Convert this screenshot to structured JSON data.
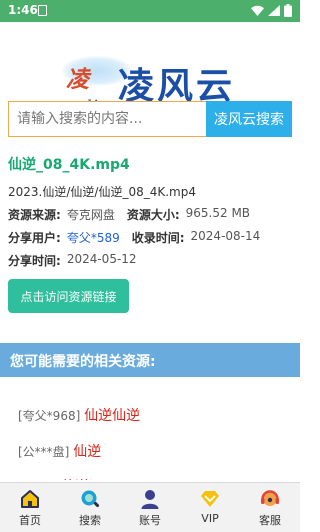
{
  "status_bar": {
    "time": "1:46"
  },
  "logo": {
    "brand_char": "凌",
    "title": "凌风云",
    "domain": "www.lingfengyun.com"
  },
  "search": {
    "placeholder": "请输入搜索的内容...",
    "button_label": "凌风云搜索"
  },
  "file": {
    "name": "仙逆_08_4K.mp4",
    "path": "2023.仙逆/仙逆/仙逆_08_4K.mp4",
    "source_label": "资源来源:",
    "source_value": "夸克网盘",
    "size_label": "资源大小:",
    "size_value": "965.52 MB",
    "sharer_label": "分享用户:",
    "sharer_value": "夸父*589",
    "collected_label": "收录时间:",
    "collected_value": "2024-08-14",
    "shared_label": "分享时间:",
    "shared_value": "2024-05-12"
  },
  "visit_button": "点击访问资源链接",
  "related": {
    "heading": "您可能需要的相关资源:",
    "items": [
      {
        "who": "[夸父*968]",
        "title": "仙逆仙逆"
      },
      {
        "who": "[公***盘]",
        "title": "仙逆"
      },
      {
        "who": "[*****]",
        "title": "仙逆"
      }
    ]
  },
  "bottom_nav": [
    {
      "label": "首页",
      "icon": "home-icon"
    },
    {
      "label": "搜索",
      "icon": "search-icon"
    },
    {
      "label": "账号",
      "icon": "user-icon"
    },
    {
      "label": "VIP",
      "icon": "vip-icon"
    },
    {
      "label": "客服",
      "icon": "support-icon"
    }
  ],
  "colors": {
    "status_bar": "#4caf6b",
    "search_button": "#2db0ea",
    "file_name": "#19a86f",
    "visit_button": "#2fbf9c",
    "related_bar": "#6aabde",
    "related_title": "#d9261c"
  }
}
